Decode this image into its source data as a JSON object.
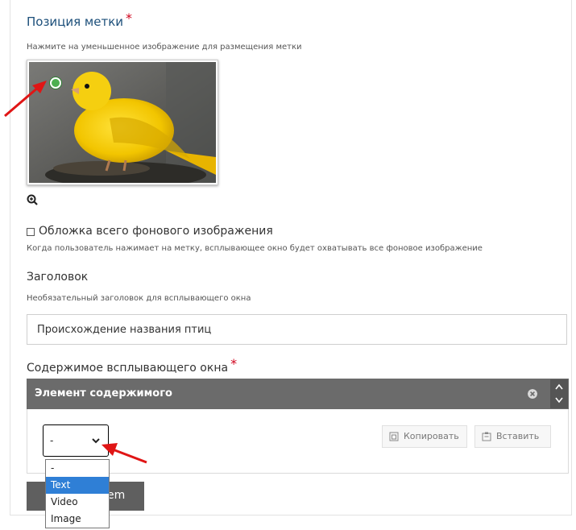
{
  "position": {
    "title": "Позиция метки",
    "required_mark": "*",
    "hint": "Нажмите на уменьшенное изображение для размещения метки"
  },
  "cover": {
    "label": "Обложка всего фонового изображения",
    "hint": "Когда пользователь нажимает на метку, всплывающее окно будет охватывать все фоновое изображение",
    "checked": false
  },
  "header_field": {
    "label": "Заголовок",
    "hint": "Необязательный заголовок для всплывающего окна",
    "value": "Происхождение названия птиц"
  },
  "popup": {
    "label": "Содержимое всплывающего окна",
    "required_mark": "*",
    "group_title": "Элемент содержимого",
    "select_value": "-",
    "copy_label": "Копировать",
    "paste_label": "Вставить",
    "options": [
      "-",
      "Text",
      "Video",
      "Image"
    ],
    "highlighted_option": "Text",
    "add_button_visible_text": "em"
  },
  "colors": {
    "title_blue": "#1c4f7a",
    "required_red": "#d0021b",
    "annotation_red": "#e01515",
    "marker_green": "#4caf50",
    "group_header": "#6b6b6b",
    "option_highlight": "#2f7fd6"
  },
  "icons": [
    "zoom-in-icon",
    "close-circle-icon",
    "chevron-up-icon",
    "chevron-down-icon",
    "copy-icon",
    "paste-icon"
  ]
}
